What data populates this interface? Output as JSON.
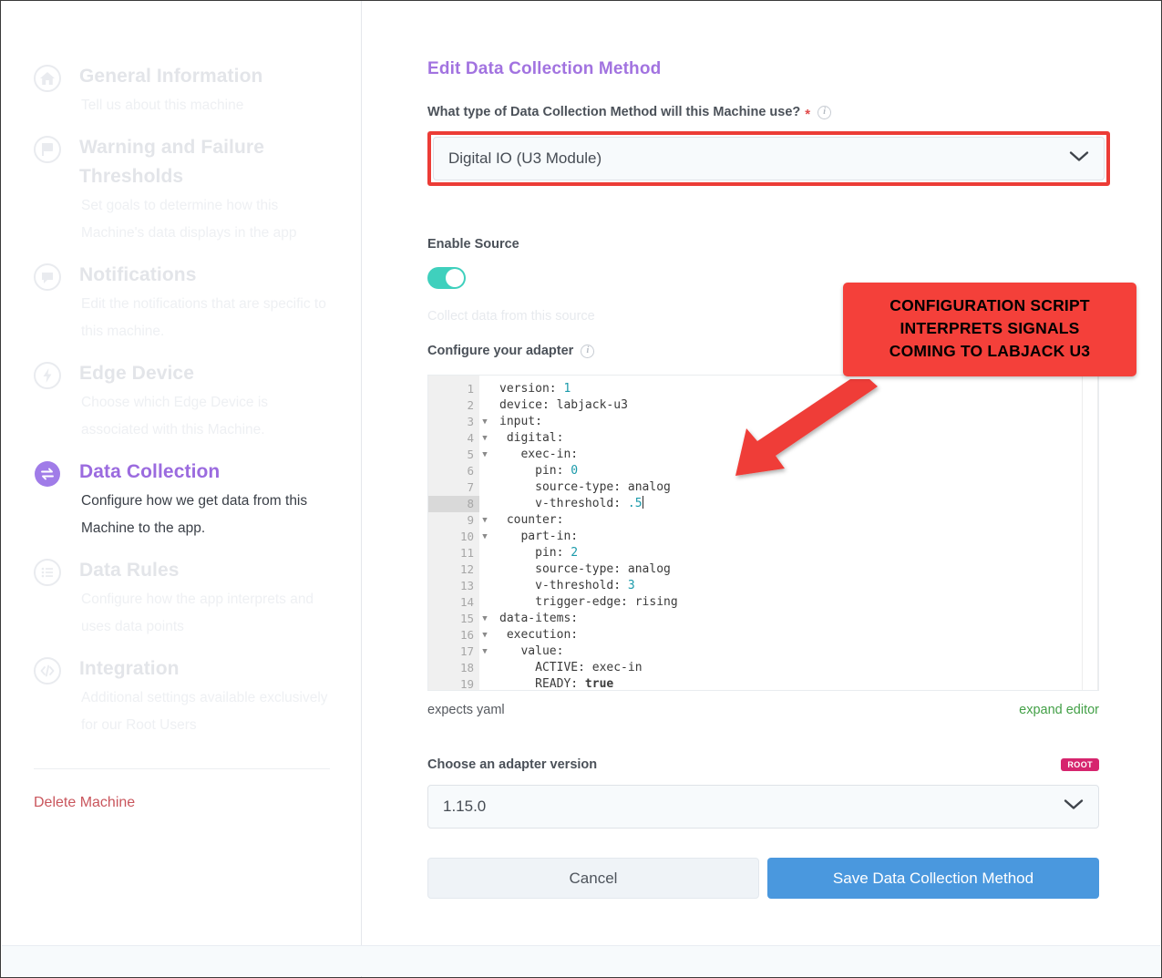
{
  "sidebar": {
    "items": [
      {
        "icon": "home-icon",
        "title": "General Information",
        "desc": "Tell us about this machine",
        "active": false
      },
      {
        "icon": "flag-icon",
        "title": "Warning and Failure Thresholds",
        "desc": "Set goals to determine how this Machine's data displays in the app",
        "active": false
      },
      {
        "icon": "chat-icon",
        "title": "Notifications",
        "desc": "Edit the notifications that are specific to this machine.",
        "active": false
      },
      {
        "icon": "bolt-icon",
        "title": "Edge Device",
        "desc": "Choose which Edge Device is associated with this Machine.",
        "active": false
      },
      {
        "icon": "exchange-icon",
        "title": "Data Collection",
        "desc": "Configure how we get data from this Machine to the app.",
        "active": true
      },
      {
        "icon": "list-icon",
        "title": "Data Rules",
        "desc": "Configure how the app interprets and uses data points",
        "active": false
      },
      {
        "icon": "code-icon",
        "title": "Integration",
        "desc": "Additional settings available exclusively for our Root Users",
        "active": false
      }
    ],
    "delete_label": "Delete Machine"
  },
  "main": {
    "title": "Edit Data Collection Method",
    "method_question": "What type of Data Collection Method will this Machine use?",
    "required_marker": "*",
    "method_value": "Digital IO (U3 Module)",
    "enable_source_label": "Enable Source",
    "enable_source_state": "on",
    "collect_hint": "Collect data from this source",
    "configure_label": "Configure your adapter",
    "editor_footer_left": "expects yaml",
    "editor_footer_right": "expand editor",
    "version_label": "Choose an adapter version",
    "root_badge": "ROOT",
    "version_value": "1.15.0",
    "cancel_label": "Cancel",
    "save_label": "Save Data Collection Method"
  },
  "editor": {
    "current_line": 8,
    "fold_lines": [
      3,
      4,
      5,
      9,
      10,
      15,
      16,
      17
    ],
    "lines": [
      {
        "n": 1,
        "text": "version: 1"
      },
      {
        "n": 2,
        "text": "device: labjack-u3"
      },
      {
        "n": 3,
        "text": "input:"
      },
      {
        "n": 4,
        "text": " digital:"
      },
      {
        "n": 5,
        "text": "   exec-in:"
      },
      {
        "n": 6,
        "text": "     pin: 0"
      },
      {
        "n": 7,
        "text": "     source-type: analog"
      },
      {
        "n": 8,
        "text": "     v-threshold: .5"
      },
      {
        "n": 9,
        "text": " counter:"
      },
      {
        "n": 10,
        "text": "   part-in:"
      },
      {
        "n": 11,
        "text": "     pin: 2"
      },
      {
        "n": 12,
        "text": "     source-type: analog"
      },
      {
        "n": 13,
        "text": "     v-threshold: 3"
      },
      {
        "n": 14,
        "text": "     trigger-edge: rising"
      },
      {
        "n": 15,
        "text": "data-items:"
      },
      {
        "n": 16,
        "text": " execution:"
      },
      {
        "n": 17,
        "text": "   value:"
      },
      {
        "n": 18,
        "text": "     ACTIVE: exec-in"
      },
      {
        "n": 19,
        "text": "     READY: true"
      }
    ]
  },
  "callout": {
    "line1": "CONFIGURATION SCRIPT",
    "line2": "INTERPRETS SIGNALS",
    "line3": "COMING TO LABJACK U3",
    "color": "#f4403a"
  },
  "colors": {
    "accent_purple": "#a273e0",
    "toggle_green": "#3fd0bd",
    "save_blue": "#4a98de",
    "badge_pink": "#d6256e",
    "callout_red": "#f4403a",
    "highlight_red": "#ec3c36",
    "link_green": "#43a047",
    "delete_red": "#c9555c"
  }
}
